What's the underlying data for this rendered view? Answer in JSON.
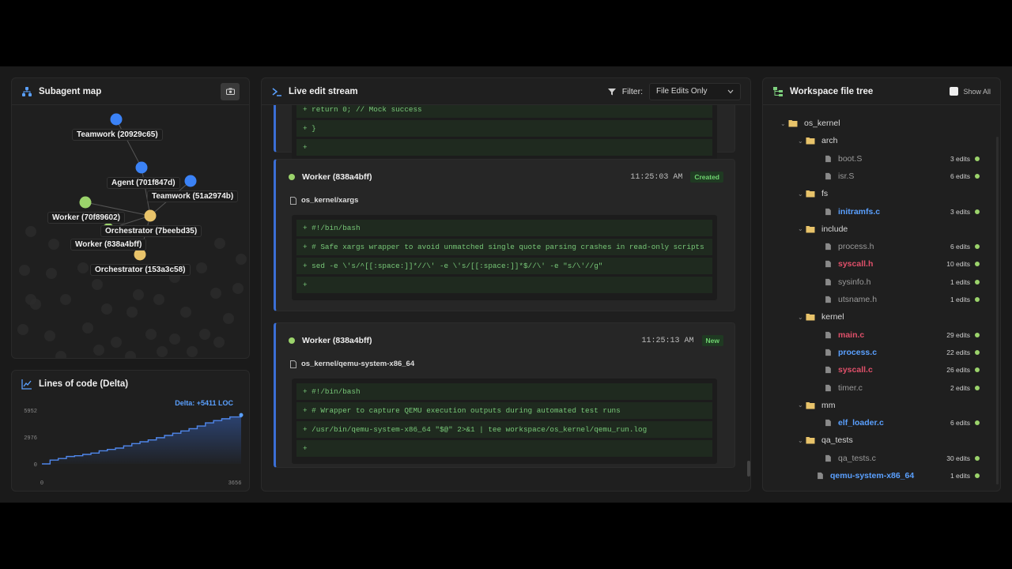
{
  "colors": {
    "accent": "#3b6fd6",
    "green": "#9bd36b",
    "orange": "#e8c36a",
    "red": "#e0506a",
    "blue_file": "#5aa0ff"
  },
  "map": {
    "title": "Subagent map",
    "nodes": [
      {
        "label": "Teamwork (20929c65)",
        "color": "#3b82f6"
      },
      {
        "label": "Agent (701f847d)",
        "color": "#3b82f6"
      },
      {
        "label": "Teamwork (51a2974b)",
        "color": "#3b82f6"
      },
      {
        "label": "Worker (70f89602)",
        "color": "#9bd36b"
      },
      {
        "label": "Orchestrator (7beebd35)",
        "color": "#e8c36a"
      },
      {
        "label": "Worker (838a4bff)",
        "color": "#9bd36b"
      },
      {
        "label": "Orchestrator (153a3c58)",
        "color": "#e8c36a"
      }
    ]
  },
  "loc": {
    "title": "Lines of code (Delta)",
    "delta_label": "Delta: +5411 LOC",
    "chart_data": {
      "type": "area",
      "title": "Lines of code (Delta)",
      "y_ticks": [
        "5952",
        "2976",
        "0"
      ],
      "x_ticks": [
        "0",
        "3656"
      ],
      "ylim": [
        0,
        5952
      ],
      "xlim": [
        0,
        3656
      ],
      "x": [
        0,
        150,
        300,
        450,
        600,
        750,
        900,
        1050,
        1200,
        1350,
        1500,
        1650,
        1800,
        1950,
        2100,
        2250,
        2400,
        2550,
        2700,
        2850,
        3000,
        3150,
        3300,
        3450,
        3656
      ],
      "y": [
        0,
        420,
        600,
        820,
        900,
        1050,
        1200,
        1450,
        1600,
        1750,
        2000,
        2250,
        2450,
        2650,
        2900,
        3150,
        3400,
        3650,
        3900,
        4200,
        4550,
        4800,
        5000,
        5200,
        5411
      ]
    }
  },
  "stream": {
    "title": "Live edit stream",
    "filter_label": "Filter:",
    "filter_value": "File Edits Only",
    "top_card": {
      "lines": [
        "+ return 0; // Mock success",
        "+ }",
        "+"
      ]
    },
    "cards": [
      {
        "agent": "Worker (838a4bff)",
        "time": "11:25:03 AM",
        "badge": "Created",
        "file": "os_kernel/xargs",
        "lines": [
          "+ #!/bin/bash",
          "+ # Safe xargs wrapper to avoid unmatched single quote parsing crashes in read-only scripts",
          "+ sed -e \\'s/^[[:space:]]*//\\' -e \\'s/[[:space:]]*$//\\' -e \"s/\\'//g\"",
          "+"
        ]
      },
      {
        "agent": "Worker (838a4bff)",
        "time": "11:25:13 AM",
        "badge": "New",
        "file": "os_kernel/qemu-system-x86_64",
        "lines": [
          "+ #!/bin/bash",
          "+ # Wrapper to capture QEMU execution outputs during automated test runs",
          "+ /usr/bin/qemu-system-x86_64 \"$@\" 2>&1 | tee workspace/os_kernel/qemu_run.log",
          "+"
        ]
      }
    ]
  },
  "tree": {
    "title": "Workspace file tree",
    "show_all": "Show All",
    "rows": [
      {
        "name": "os_kernel",
        "type": "folder",
        "depth": 0,
        "edits": ""
      },
      {
        "name": "arch",
        "type": "folder",
        "depth": 1,
        "edits": ""
      },
      {
        "name": "boot.S",
        "type": "file",
        "depth": 2,
        "edits": "3 edits",
        "color": "#9a9a9a"
      },
      {
        "name": "isr.S",
        "type": "file",
        "depth": 2,
        "edits": "6 edits",
        "color": "#9a9a9a"
      },
      {
        "name": "fs",
        "type": "folder",
        "depth": 1,
        "edits": ""
      },
      {
        "name": "initramfs.c",
        "type": "file",
        "depth": 2,
        "edits": "3 edits",
        "color": "#5aa0ff"
      },
      {
        "name": "include",
        "type": "folder",
        "depth": 1,
        "edits": ""
      },
      {
        "name": "process.h",
        "type": "file",
        "depth": 2,
        "edits": "6 edits",
        "color": "#9a9a9a"
      },
      {
        "name": "syscall.h",
        "type": "file",
        "depth": 2,
        "edits": "10 edits",
        "color": "#e0506a"
      },
      {
        "name": "sysinfo.h",
        "type": "file",
        "depth": 2,
        "edits": "1 edits",
        "color": "#9a9a9a"
      },
      {
        "name": "utsname.h",
        "type": "file",
        "depth": 2,
        "edits": "1 edits",
        "color": "#9a9a9a"
      },
      {
        "name": "kernel",
        "type": "folder",
        "depth": 1,
        "edits": ""
      },
      {
        "name": "main.c",
        "type": "file",
        "depth": 2,
        "edits": "29 edits",
        "color": "#e0506a"
      },
      {
        "name": "process.c",
        "type": "file",
        "depth": 2,
        "edits": "22 edits",
        "color": "#5aa0ff"
      },
      {
        "name": "syscall.c",
        "type": "file",
        "depth": 2,
        "edits": "26 edits",
        "color": "#e0506a"
      },
      {
        "name": "timer.c",
        "type": "file",
        "depth": 2,
        "edits": "2 edits",
        "color": "#9a9a9a"
      },
      {
        "name": "mm",
        "type": "folder",
        "depth": 1,
        "edits": ""
      },
      {
        "name": "elf_loader.c",
        "type": "file",
        "depth": 2,
        "edits": "6 edits",
        "color": "#5aa0ff"
      },
      {
        "name": "qa_tests",
        "type": "folder",
        "depth": 1,
        "edits": ""
      },
      {
        "name": "qa_tests.c",
        "type": "file",
        "depth": 2,
        "edits": "30 edits",
        "color": "#9a9a9a"
      },
      {
        "name": "qemu-system-x86_64",
        "type": "file",
        "depth": 1,
        "edits": "1 edits",
        "color": "#5aa0ff"
      }
    ]
  }
}
